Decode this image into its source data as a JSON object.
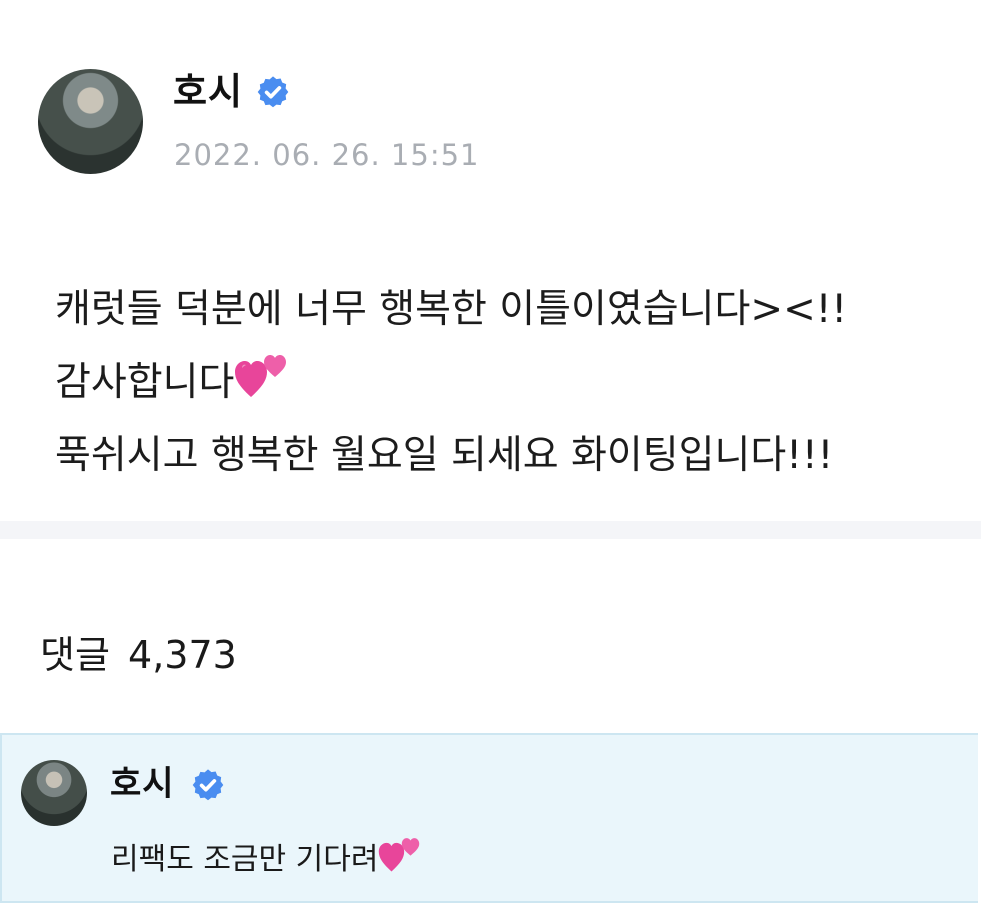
{
  "post": {
    "author": "호시",
    "timestamp": "2022. 06. 26. 15:51",
    "lines": [
      "캐럿들 덕분에 너무 행복한 이틀이였습니다><!!",
      "감사합니다",
      "푹쉬시고 행복한 월요일 되세요 화이팅입니다!!!"
    ]
  },
  "comments": {
    "label": "댓글",
    "count": "4,373",
    "items": [
      {
        "author": "호시",
        "text": "리팩도 조금만 기다려"
      }
    ]
  },
  "icons": {
    "verified": "verified-badge-icon",
    "heart": "two-hearts-emoji"
  },
  "colors": {
    "verified": "#4a8df0",
    "heart": "#e8459a",
    "timestamp": "#a9adb3",
    "comment_highlight_bg": "#eaf6fb",
    "divider": "#f4f5f8"
  }
}
